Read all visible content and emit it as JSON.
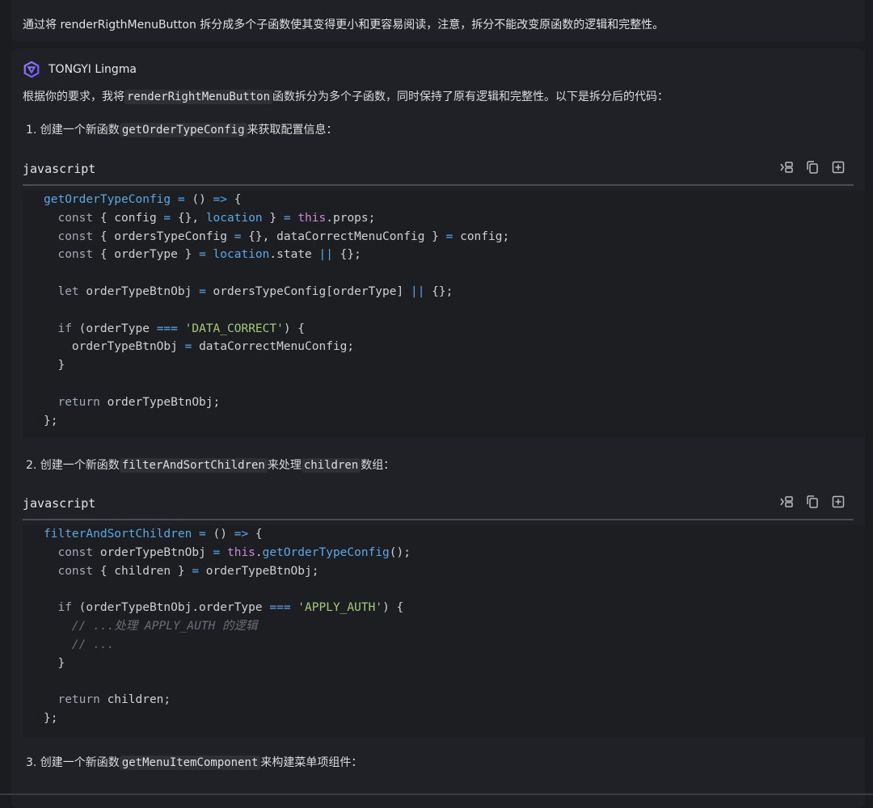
{
  "user_message": {
    "text": "通过将 renderRigthMenuButton 拆分成多个子函数使其变得更小和更容易阅读，注意，拆分不能改变原函数的逻辑和完整性。"
  },
  "top_more_label": "···",
  "assistant": {
    "name": "TONGYI Lingma",
    "intro": {
      "before": "根据你的要求，我将",
      "code": "renderRightMenuButton",
      "after": "函数拆分为多个子函数，同时保持了原有逻辑和完整性。以下是拆分后的代码："
    },
    "steps": [
      {
        "prefix": "1. 创建一个新函数",
        "code": "getOrderTypeConfig",
        "suffix": "来获取配置信息："
      },
      {
        "prefix": "2. 创建一个新函数",
        "code": "filterAndSortChildren",
        "middle": "来处理",
        "code2": "children",
        "suffix": "数组："
      },
      {
        "prefix": "3. 创建一个新函数",
        "code": "getMenuItemComponent",
        "suffix": "来构建菜单项组件："
      }
    ],
    "code_blocks": [
      {
        "language": "javascript",
        "lines": [
          [
            [
              "getOrderTypeConfig",
              "fn"
            ],
            [
              " = ",
              "op"
            ],
            [
              "() ",
              "p"
            ],
            [
              "=>",
              "op"
            ],
            [
              " {",
              "p"
            ]
          ],
          [
            [
              "  const",
              "kw"
            ],
            [
              " { config ",
              "p"
            ],
            [
              "=",
              "op"
            ],
            [
              " {}, ",
              "p"
            ],
            [
              "location",
              "fn"
            ],
            [
              " } ",
              "p"
            ],
            [
              "=",
              "op"
            ],
            [
              " ",
              "p"
            ],
            [
              "this",
              "this"
            ],
            [
              ".props;",
              "p"
            ]
          ],
          [
            [
              "  const",
              "kw"
            ],
            [
              " { ordersTypeConfig ",
              "p"
            ],
            [
              "=",
              "op"
            ],
            [
              " {}, dataCorrectMenuConfig } ",
              "p"
            ],
            [
              "=",
              "op"
            ],
            [
              " config;",
              "p"
            ]
          ],
          [
            [
              "  const",
              "kw"
            ],
            [
              " { orderType } ",
              "p"
            ],
            [
              "=",
              "op"
            ],
            [
              " ",
              "p"
            ],
            [
              "location",
              "fn"
            ],
            [
              ".state ",
              "p"
            ],
            [
              "||",
              "op"
            ],
            [
              " {};",
              "p"
            ]
          ],
          [],
          [
            [
              "  let",
              "kw"
            ],
            [
              " orderTypeBtnObj ",
              "p"
            ],
            [
              "=",
              "op"
            ],
            [
              " ordersTypeConfig[orderType] ",
              "p"
            ],
            [
              "||",
              "op"
            ],
            [
              " {};",
              "p"
            ]
          ],
          [],
          [
            [
              "  if",
              "kw"
            ],
            [
              " (orderType ",
              "p"
            ],
            [
              "===",
              "op"
            ],
            [
              " ",
              "p"
            ],
            [
              "'DATA_CORRECT'",
              "str"
            ],
            [
              ") {",
              "p"
            ]
          ],
          [
            [
              "    orderTypeBtnObj ",
              "p"
            ],
            [
              "=",
              "op"
            ],
            [
              " dataCorrectMenuConfig;",
              "p"
            ]
          ],
          [
            [
              "  }",
              "p"
            ]
          ],
          [],
          [
            [
              "  return",
              "kw"
            ],
            [
              " orderTypeBtnObj;",
              "p"
            ]
          ],
          [
            [
              "};",
              "p"
            ]
          ]
        ]
      },
      {
        "language": "javascript",
        "lines": [
          [
            [
              "filterAndSortChildren",
              "fn"
            ],
            [
              " = ",
              "op"
            ],
            [
              "() ",
              "p"
            ],
            [
              "=>",
              "op"
            ],
            [
              " {",
              "p"
            ]
          ],
          [
            [
              "  const",
              "kw"
            ],
            [
              " orderTypeBtnObj ",
              "p"
            ],
            [
              "=",
              "op"
            ],
            [
              " ",
              "p"
            ],
            [
              "this",
              "this"
            ],
            [
              ".",
              "p"
            ],
            [
              "getOrderTypeConfig",
              "fn"
            ],
            [
              "();",
              "p"
            ]
          ],
          [
            [
              "  const",
              "kw"
            ],
            [
              " { children } ",
              "p"
            ],
            [
              "=",
              "op"
            ],
            [
              " orderTypeBtnObj;",
              "p"
            ]
          ],
          [],
          [
            [
              "  if",
              "kw"
            ],
            [
              " (orderTypeBtnObj.orderType ",
              "p"
            ],
            [
              "===",
              "op"
            ],
            [
              " ",
              "p"
            ],
            [
              "'APPLY_AUTH'",
              "str"
            ],
            [
              ") {",
              "p"
            ]
          ],
          [
            [
              "    // ...处理 APPLY_AUTH 的逻辑",
              "cm"
            ]
          ],
          [
            [
              "    // ...",
              "cm"
            ]
          ],
          [
            [
              "  }",
              "p"
            ]
          ],
          [],
          [
            [
              "  return",
              "kw"
            ],
            [
              " children;",
              "p"
            ]
          ],
          [
            [
              "};",
              "p"
            ]
          ]
        ]
      }
    ],
    "code_actions": [
      "insert-icon",
      "copy-icon",
      "new-file-icon"
    ]
  },
  "colors": {
    "fn": "#59a8e8",
    "kw": "#a3a8b6",
    "op": "#59a8e8",
    "p": "#d0d0d4",
    "this": "#c68bd6",
    "str": "#a9c97a",
    "cm": "#6c6e76"
  }
}
